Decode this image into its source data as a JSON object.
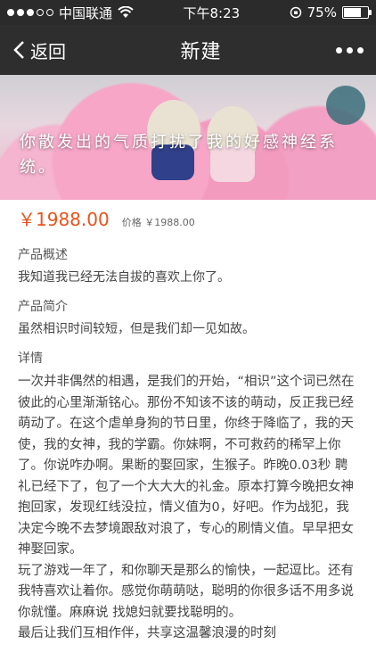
{
  "status_bar": {
    "carrier": "中国联通",
    "time": "下午8:23",
    "battery_percent": "75%",
    "battery_level": 0.75
  },
  "nav": {
    "back_label": "返回",
    "title": "新建"
  },
  "banner": {
    "overlay_text": "你散发出的气质打扰了我的好感神经系统。"
  },
  "price": {
    "current": "￥1988.00",
    "original": "价格 ￥1988.00"
  },
  "sections": {
    "overview_label": "产品概述",
    "overview_text": "我知道我已经无法自拔的喜欢上你了。",
    "intro_label": "产品简介",
    "intro_text": "虽然相识时间较短，但是我们却一见如故。",
    "details_label": "详情",
    "details_p1": "一次并非偶然的相遇，是我们的开始，“相识”这个词已然在彼此的心里渐渐铭心。那份不知该不该的萌动，反正我已经萌动了。在这个虐单身狗的节日里，你终于降临了，我的天使，我的女神，我的学霸。你妹啊，不可救药的稀罕上你了。你说咋办啊。果断的娶回家，生猴子。昨晚0.03秒 聘礼已经下了，包了一个大大大的礼金。原本打算今晚把女神抱回家，发现红线没拉，情义值为0，好吧。作为战犯，我决定今晚不去梦境跟敌对浪了，专心的刷情义值。早早把女神娶回家。",
    "details_p2": "玩了游戏一年了，和你聊天是那么的愉快，一起逗比。还有我特喜欢让着你。感觉你萌萌哒，聪明的你很多话不用多说你就懂。麻麻说 找媳妇就要找聪明的。",
    "details_p3": "最后让我们互相作伴，共享这温馨浪漫的时刻"
  }
}
